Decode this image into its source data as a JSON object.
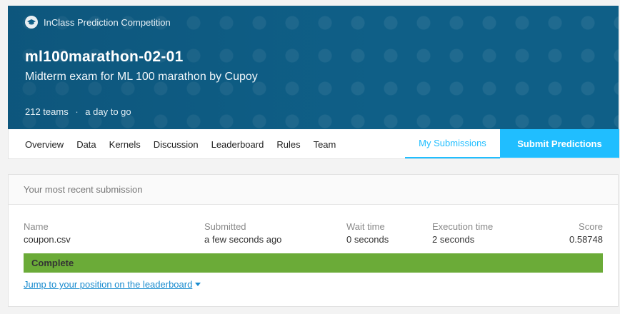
{
  "banner": {
    "competition_type": "InClass Prediction Competition",
    "competition_icon": "graduation-cap-icon",
    "title": "ml100marathon-02-01",
    "subtitle": "Midterm exam for ML 100 marathon by Cupoy",
    "teams": "212 teams",
    "separator": "·",
    "deadline": "a day to go",
    "background_color": "#0f5f87"
  },
  "nav": {
    "tabs": [
      "Overview",
      "Data",
      "Kernels",
      "Discussion",
      "Leaderboard",
      "Rules",
      "Team"
    ],
    "my_submissions": "My Submissions",
    "submit_predictions": "Submit Predictions",
    "accent_color": "#20beff"
  },
  "submission": {
    "header": "Your most recent submission",
    "columns": {
      "name_label": "Name",
      "name_value": "coupon.csv",
      "submitted_label": "Submitted",
      "submitted_value": "a few seconds ago",
      "wait_label": "Wait time",
      "wait_value": "0 seconds",
      "exec_label": "Execution time",
      "exec_value": "2 seconds",
      "score_label": "Score",
      "score_value": "0.58748"
    },
    "status": "Complete",
    "status_color": "#6bab38",
    "jump_link": "Jump to your position on the leaderboard"
  }
}
